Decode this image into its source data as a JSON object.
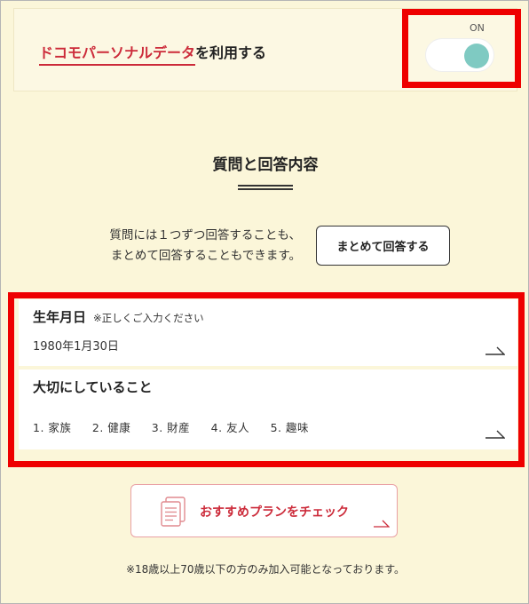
{
  "consent": {
    "link_text": "ドコモパーソナルデータ",
    "suffix_text": "を利用する",
    "toggle_state_label": "ON"
  },
  "section": {
    "title": "質問と回答内容",
    "description_line1": "質問には１つずつ回答することも、",
    "description_line2": "まとめて回答することもできます。",
    "bulk_answer_button": "まとめて回答する"
  },
  "answers": {
    "birthdate": {
      "label": "生年月日",
      "note": "※正しくご入力ください",
      "value": "1980年1月30日"
    },
    "values": {
      "label": "大切にしていること",
      "items": [
        "1. 家族",
        "2. 健康",
        "3. 財産",
        "4. 友人",
        "5. 趣味"
      ]
    }
  },
  "recommend_button": "おすすめプランをチェック",
  "footnote": "※18歳以上70歳以下の方のみ加入可能となっております。",
  "colors": {
    "background": "#fbf6d9",
    "accent_red": "#cc2b3a",
    "toggle_on": "#7fcac2",
    "highlight": "#ee0000"
  },
  "icons": {
    "toggle": "toggle-switch-icon",
    "arrow": "arrow-right-icon",
    "document": "document-stack-icon"
  }
}
